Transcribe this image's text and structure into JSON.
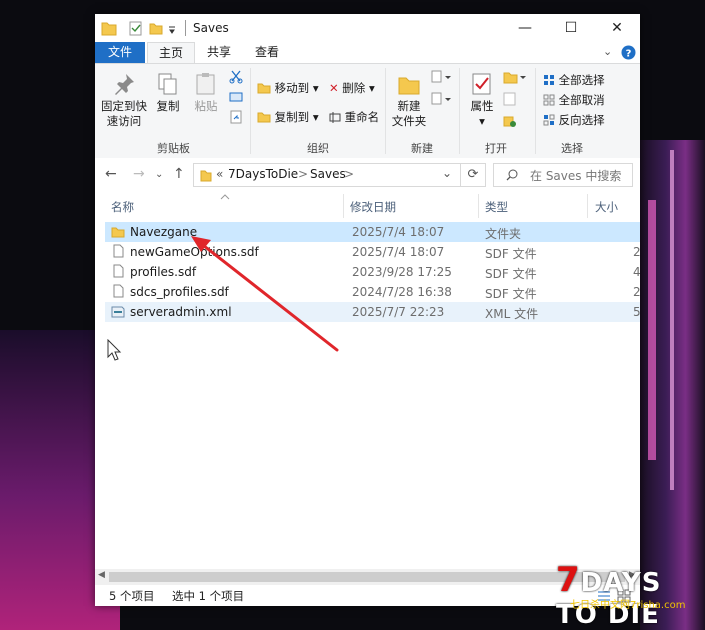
{
  "window": {
    "title": "Saves",
    "controls": {
      "minimize": "—",
      "maximize": "☐",
      "close": "✕"
    }
  },
  "tabs": {
    "file": "文件",
    "home": "主页",
    "share": "共享",
    "view": "查看"
  },
  "ribbon": {
    "clipboard": {
      "pin_label_1": "固定到快",
      "pin_label_2": "速访问",
      "copy": "复制",
      "paste": "粘贴",
      "group": "剪贴板"
    },
    "organize": {
      "move_to": "移动到",
      "copy_to": "复制到",
      "delete": "删除",
      "rename": "重命名",
      "group": "组织"
    },
    "new": {
      "new_folder_1": "新建",
      "new_folder_2": "文件夹",
      "group": "新建"
    },
    "open": {
      "properties": "属性",
      "group": "打开"
    },
    "select": {
      "select_all": "全部选择",
      "select_none": "全部取消",
      "invert": "反向选择",
      "group": "选择"
    }
  },
  "address": {
    "overflow": "«",
    "parent": "7DaysToDie",
    "separator": ">",
    "current": "Saves",
    "search_placeholder": "在 Saves 中搜索"
  },
  "columns": {
    "name": "名称",
    "date": "修改日期",
    "type": "类型",
    "size": "大小"
  },
  "files": [
    {
      "name": "Navezgane",
      "date": "2025/7/4 18:07",
      "type": "文件夹",
      "size": "",
      "icon": "folder-icon",
      "selected": true
    },
    {
      "name": "newGameOptions.sdf",
      "date": "2025/7/4 18:07",
      "type": "SDF 文件",
      "size": "2",
      "icon": "file-icon"
    },
    {
      "name": "profiles.sdf",
      "date": "2023/9/28 17:25",
      "type": "SDF 文件",
      "size": "4",
      "icon": "file-icon"
    },
    {
      "name": "sdcs_profiles.sdf",
      "date": "2024/7/28 16:38",
      "type": "SDF 文件",
      "size": "2",
      "icon": "file-icon"
    },
    {
      "name": "serveradmin.xml",
      "date": "2025/7/7 22:23",
      "type": "XML 文件",
      "size": "5",
      "icon": "xml-file-icon"
    }
  ],
  "status": {
    "count": "5 个项目",
    "selected": "选中 1 个项目"
  },
  "watermark": {
    "seven": "7",
    "logo": "DAYS TO DIE",
    "sub": "七日杀中文网7risha.com"
  },
  "colors": {
    "accent": "#1f6fc6",
    "selection": "#cce8ff",
    "arrow": "#e0262b"
  }
}
